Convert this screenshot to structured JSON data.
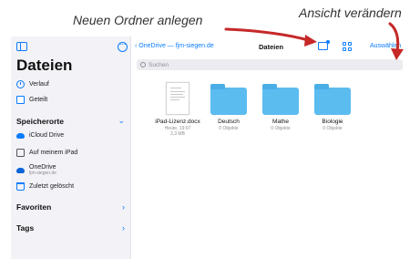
{
  "annotations": {
    "new_folder": "Neuen Ordner anlegen",
    "change_view": "Ansicht verändern",
    "arrow_color": "#c62828"
  },
  "sidebar": {
    "title": "Dateien",
    "items": [
      {
        "label": "Verlauf",
        "icon": "clock-icon"
      },
      {
        "label": "Geteilt",
        "icon": "shared-folder-icon"
      }
    ],
    "locations_title": "Speicherorte",
    "locations": [
      {
        "label": "iCloud Drive",
        "icon": "icloud-icon"
      },
      {
        "label": "Auf meinem iPad",
        "icon": "ipad-icon"
      },
      {
        "label": "OneDrive",
        "sub": "fjm-siegen.de",
        "icon": "onedrive-icon"
      },
      {
        "label": "Zuletzt gelöscht",
        "icon": "trash-icon"
      }
    ],
    "favorites_title": "Favoriten",
    "tags_title": "Tags"
  },
  "toolbar": {
    "back_label": "OneDrive — fjm-siegen.de",
    "title": "Dateien",
    "select_label": "Auswählen"
  },
  "search": {
    "placeholder": "Suchen"
  },
  "files": [
    {
      "name": "iPad-Lizenz.docx",
      "meta1": "Heute, 19:07",
      "meta2": "2,3 MB",
      "type": "document"
    },
    {
      "name": "Deutsch",
      "meta1": "0 Objekte",
      "type": "folder"
    },
    {
      "name": "Mathe",
      "meta1": "0 Objekte",
      "type": "folder"
    },
    {
      "name": "Biologie",
      "meta1": "0 Objekte",
      "type": "folder"
    }
  ],
  "colors": {
    "accent": "#0a7cff",
    "folder": "#5bbcf0",
    "sidebar_bg": "#f2f2f7"
  }
}
